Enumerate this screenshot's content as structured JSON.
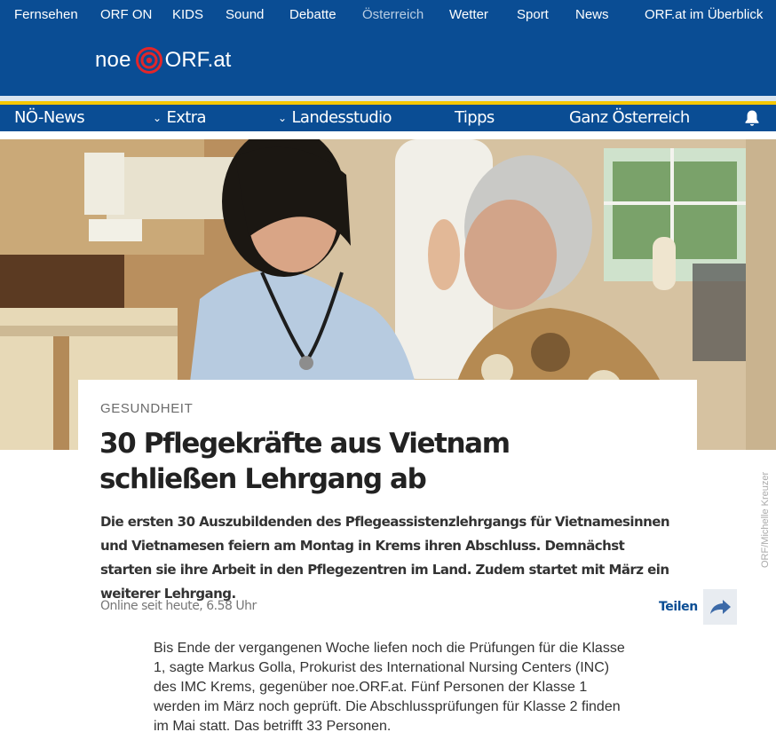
{
  "top_nav": {
    "items": [
      "Fernsehen",
      "ORF ON",
      "KIDS",
      "Sound",
      "Debatte",
      "Österreich",
      "Wetter",
      "Sport",
      "News"
    ],
    "active": "Österreich",
    "overview": "ORF.at im Überblick"
  },
  "brand": {
    "region": "noe",
    "site": "ORF.at"
  },
  "sub_nav": {
    "news": "NÖ-News",
    "extra": "Extra",
    "studio": "Landesstudio",
    "tipps": "Tipps",
    "austria": "Ganz Österreich",
    "bell_icon": "bell-icon"
  },
  "hero": {
    "credit": "ORF/Michelle Kreuzer"
  },
  "article": {
    "category": "Gesundheit",
    "title": "30 Pflegekräfte aus Vietnam schließen Lehrgang ab",
    "lead": "Die ersten 30 Auszubildenden des Pflegeassistenzlehrgangs für Vietnamesinnen und Vietnamesen feiern am Montag in Krems ihren Abschluss. Demnächst starten sie ihre Arbeit in den Pflegezentren im Land. Zudem startet mit März ein weiterer Lehrgang.",
    "published": "Online seit heute, 6.58 Uhr",
    "share_label": "Teilen",
    "share_icon": "share-arrow-icon",
    "body": "Bis Ende der vergangenen Woche liefen noch die Prüfungen für die Klasse 1, sagte Markus Golla, Prokurist des International Nursing Centers (INC) des IMC Krems, gegenüber noe.ORF.at. Fünf Personen der Klasse 1 werden im März noch geprüft. Die Abschlussprüfungen für Klasse 2 finden im Mai statt. Das betrifft 33 Personen."
  },
  "colors": {
    "brand_blue": "#0a4d94",
    "accent_yellow": "#f6c700",
    "logo_red": "#e2262a"
  }
}
